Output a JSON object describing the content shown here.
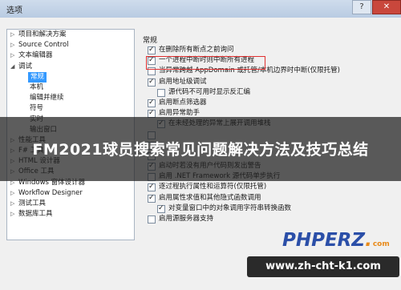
{
  "window": {
    "title": "选项"
  },
  "tree": {
    "items": [
      {
        "label": "项目和解决方案",
        "arrow": "▷",
        "child": false
      },
      {
        "label": "Source Control",
        "arrow": "▷",
        "child": false
      },
      {
        "label": "文本编辑器",
        "arrow": "▷",
        "child": false
      },
      {
        "label": "调试",
        "arrow": "◢",
        "child": false
      },
      {
        "label": "常规",
        "arrow": "",
        "child": true,
        "selected": true
      },
      {
        "label": "本机",
        "arrow": "",
        "child": true
      },
      {
        "label": "编辑并继续",
        "arrow": "",
        "child": true
      },
      {
        "label": "符号",
        "arrow": "",
        "child": true
      },
      {
        "label": "实时",
        "arrow": "",
        "child": true
      },
      {
        "label": "输出窗口",
        "arrow": "",
        "child": true
      },
      {
        "label": "性能工具",
        "arrow": "▷",
        "child": false
      },
      {
        "label": "F# 工具",
        "arrow": "▷",
        "child": false
      },
      {
        "label": "HTML 设计器",
        "arrow": "▷",
        "child": false
      },
      {
        "label": "Office 工具",
        "arrow": "▷",
        "child": false
      },
      {
        "label": "Windows 窗体设计器",
        "arrow": "▷",
        "child": false
      },
      {
        "label": "Workflow Designer",
        "arrow": "▷",
        "child": false
      },
      {
        "label": "测试工具",
        "arrow": "▷",
        "child": false
      },
      {
        "label": "数据库工具",
        "arrow": "▷",
        "child": false
      }
    ]
  },
  "general": {
    "title": "常规",
    "options": [
      {
        "label": "在删除所有断点之前询问",
        "checked": true,
        "indent": 0
      },
      {
        "label": "一个进程中断时则中断所有进程",
        "checked": true,
        "indent": 0
      },
      {
        "label": "当异常跨越 AppDomain 或托管/本机边界时中断(仅限托管)",
        "checked": false,
        "indent": 0
      },
      {
        "label": "启用地址级调试",
        "checked": true,
        "indent": 0
      },
      {
        "label": "源代码不可用时显示反汇编",
        "checked": false,
        "indent": 1
      },
      {
        "label": "启用断点筛选器",
        "checked": true,
        "indent": 0
      },
      {
        "label": "启用异常助手",
        "checked": true,
        "indent": 0
      },
      {
        "label": "在未经处理的异常上展开调用堆栈",
        "checked": true,
        "indent": 1
      },
      {
        "label": "",
        "checked": false,
        "indent": 0
      },
      {
        "label": "",
        "checked": false,
        "indent": 0
      },
      {
        "label": "",
        "checked": false,
        "indent": 0
      },
      {
        "label": "启动时若没有用户代码则发出警告",
        "checked": true,
        "indent": 0
      },
      {
        "label": "启用 .NET Framework 源代码单步执行",
        "checked": false,
        "indent": 0
      },
      {
        "label": "逐过程执行属性和运算符(仅限托管)",
        "checked": true,
        "indent": 0
      },
      {
        "label": "启用属性求值和其他隐式函数调用",
        "checked": true,
        "indent": 0
      },
      {
        "label": "对变量窗口中的对象调用字符串转换函数",
        "checked": true,
        "indent": 1
      },
      {
        "label": "启用源服务器支持",
        "checked": false,
        "indent": 0
      }
    ]
  },
  "banner": {
    "text": "FM2021球员搜索常见问题解决方法及技巧总结"
  },
  "watermark": {
    "logo": "PHPERZ",
    "logo_dot": ".",
    "logo_suffix": "com",
    "url": "www.zh-cht-k1.com"
  }
}
